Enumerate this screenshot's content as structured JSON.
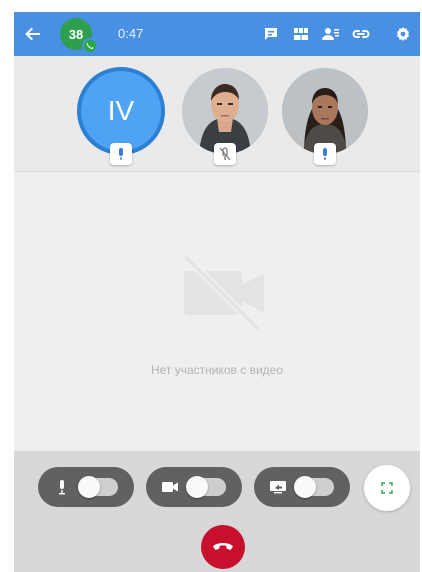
{
  "header": {
    "avatar_count": "38",
    "timer": "0:47",
    "icons": [
      "back-arrow-icon",
      "chat-icon",
      "grid-icon",
      "participants-icon",
      "link-icon",
      "settings-icon"
    ]
  },
  "participants": [
    {
      "initials": "IV",
      "mic": "on",
      "speaking": true
    },
    {
      "type": "photo",
      "mic": "muted"
    },
    {
      "type": "photo",
      "mic": "on"
    }
  ],
  "video_area": {
    "message": "Нет участников с видео"
  },
  "controls": {
    "mic_enabled": false,
    "camera_enabled": false,
    "screen_share_enabled": false
  },
  "colors": {
    "header": "#4a90e2",
    "avatar_badge": "#2e9e4f",
    "active_participant": "#4fa3f4",
    "pill": "#616161",
    "hangup": "#c8102e",
    "mic_icon": "#3b7ddd"
  }
}
